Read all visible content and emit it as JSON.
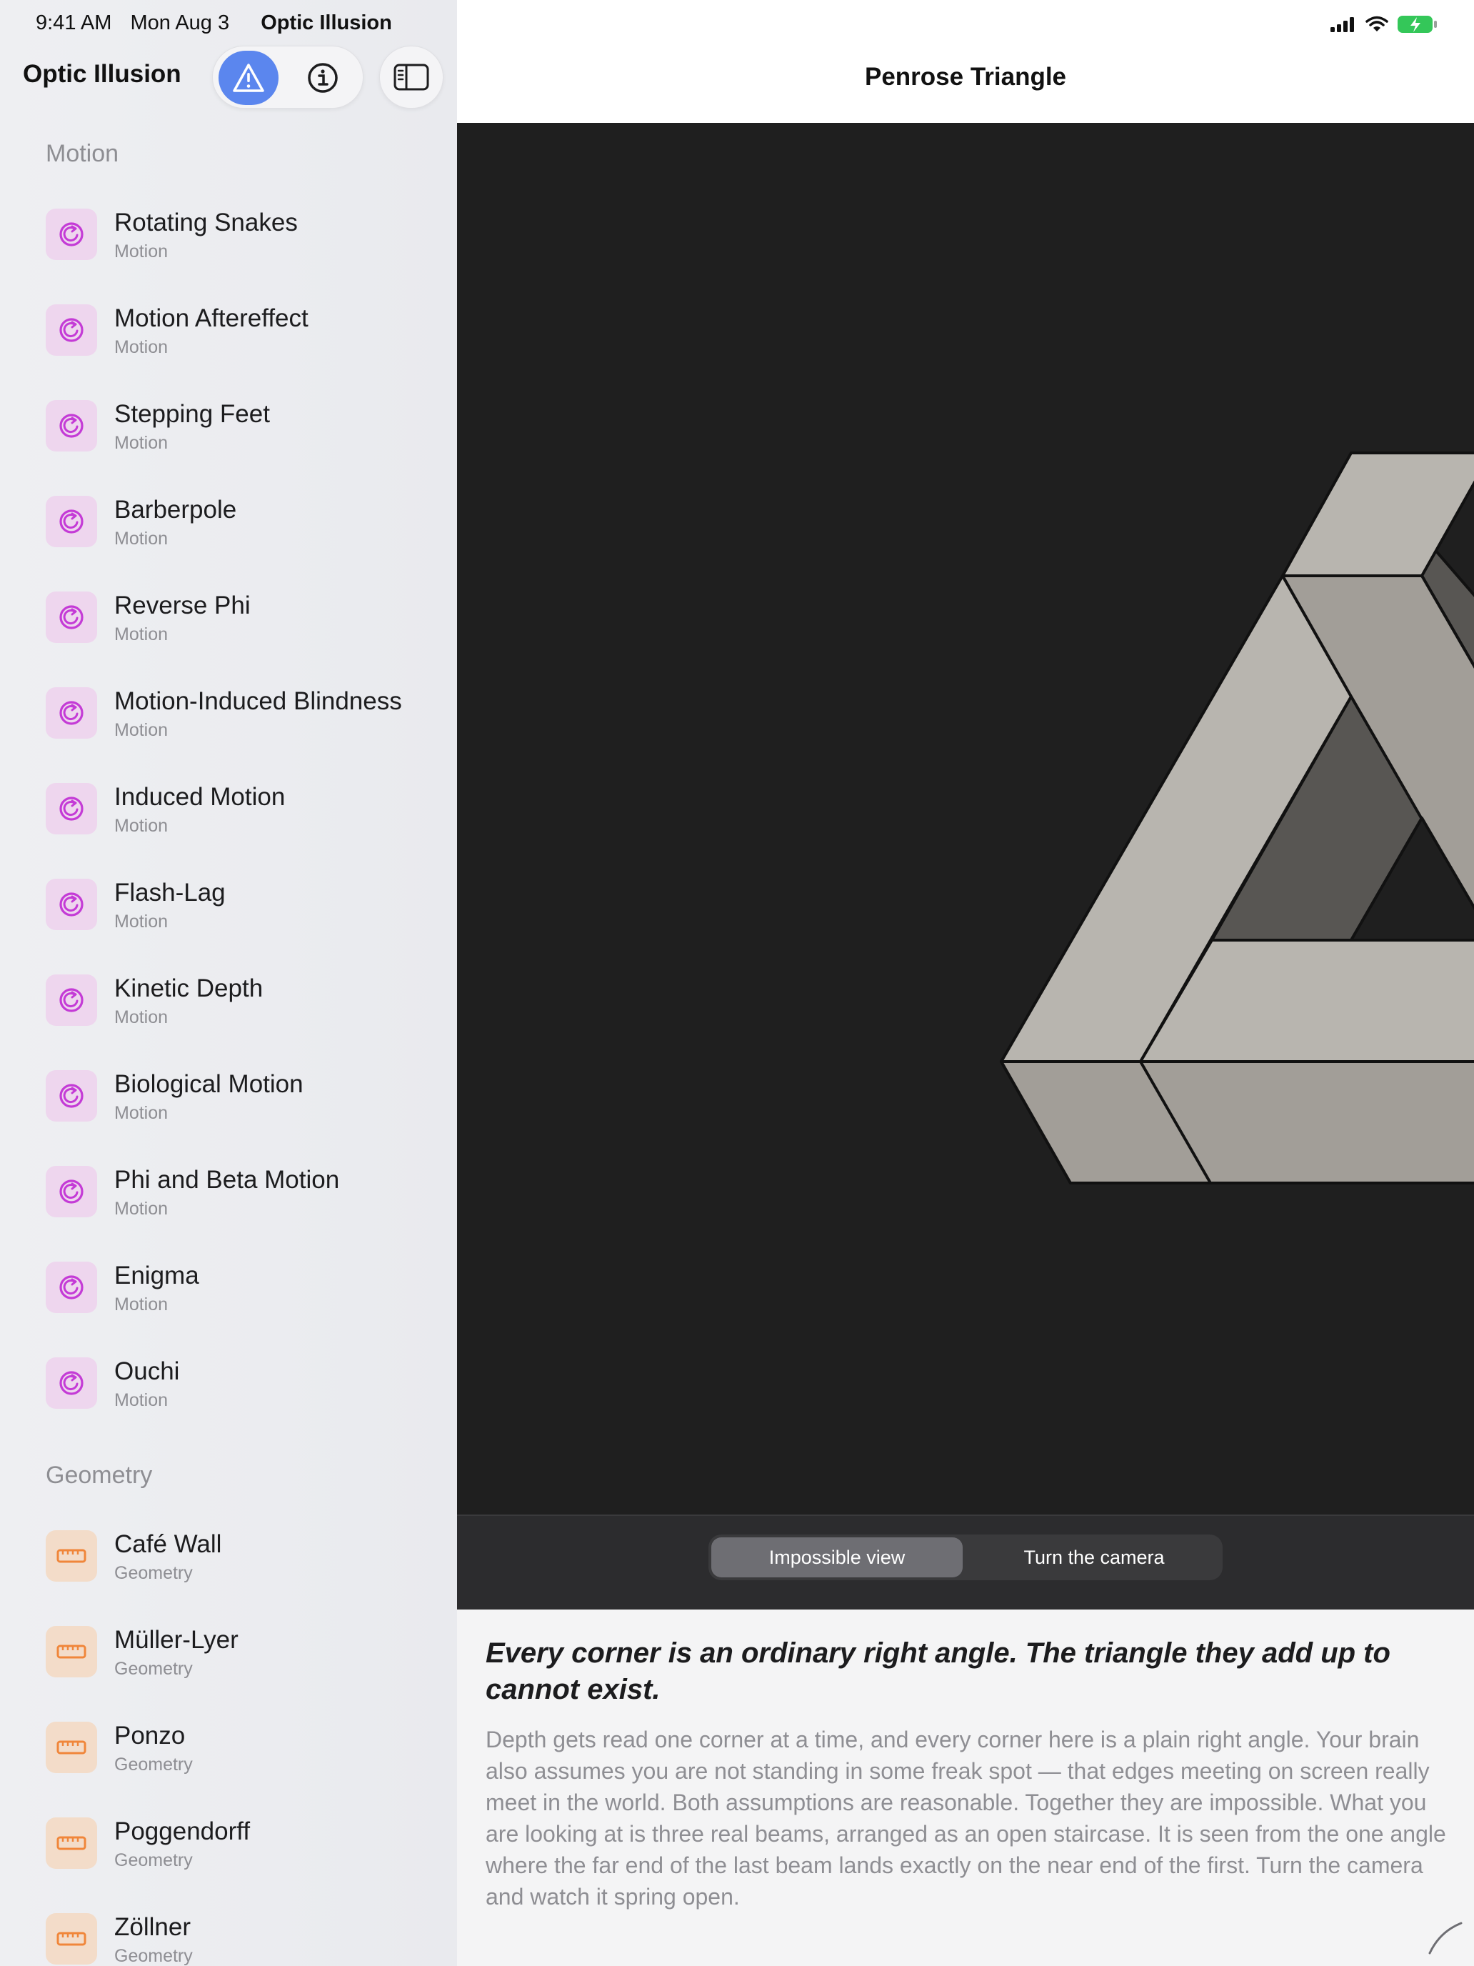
{
  "status_bar": {
    "time": "9:41 AM",
    "date": "Mon Aug 3",
    "app_name": "Optic Illusion",
    "battery_color": "#34c759"
  },
  "sidebar": {
    "title": "Optic Illusion",
    "warning_button_icon": "warning-triangle-icon",
    "info_button_icon": "info-circle-icon",
    "toggle_icon": "sidebar-toggle-icon",
    "accent": "#5b86ee",
    "sections": [
      {
        "header": "Motion",
        "icon": "rotate-arrow-icon",
        "icon_color": "#c43bd6",
        "items": [
          {
            "name": "Rotating Snakes",
            "category": "Motion"
          },
          {
            "name": "Motion Aftereffect",
            "category": "Motion"
          },
          {
            "name": "Stepping Feet",
            "category": "Motion"
          },
          {
            "name": "Barberpole",
            "category": "Motion"
          },
          {
            "name": "Reverse Phi",
            "category": "Motion"
          },
          {
            "name": "Motion-Induced Blindness",
            "category": "Motion"
          },
          {
            "name": "Induced Motion",
            "category": "Motion"
          },
          {
            "name": "Flash-Lag",
            "category": "Motion"
          },
          {
            "name": "Kinetic Depth",
            "category": "Motion"
          },
          {
            "name": "Biological Motion",
            "category": "Motion"
          },
          {
            "name": "Phi and Beta Motion",
            "category": "Motion"
          },
          {
            "name": "Enigma",
            "category": "Motion"
          },
          {
            "name": "Ouchi",
            "category": "Motion"
          }
        ]
      },
      {
        "header": "Geometry",
        "icon": "ruler-icon",
        "icon_color": "#f0863a",
        "items": [
          {
            "name": "Café Wall",
            "category": "Geometry"
          },
          {
            "name": "Müller-Lyer",
            "category": "Geometry"
          },
          {
            "name": "Ponzo",
            "category": "Geometry"
          },
          {
            "name": "Poggendorff",
            "category": "Geometry"
          },
          {
            "name": "Zöllner",
            "category": "Geometry"
          }
        ]
      }
    ]
  },
  "main": {
    "title": "Penrose Triangle",
    "segmented": {
      "options": [
        "Impossible view",
        "Turn the camera"
      ],
      "selected": "Impossible view"
    },
    "description": {
      "headline": "Every corner is an ordinary right angle. The triangle they add up to cannot exist.",
      "body": "Depth gets read one corner at a time, and every corner here is a plain right angle. Your brain also assumes you are not standing in some freak spot — that edges meeting on screen really meet in the world. Both assumptions are reasonable. Together they are impossible. What you are looking at is three real beams, arranged as an open staircase. It is seen from the one angle where the far end of the last beam lands exactly on the near end of the first. Turn the camera and watch it spring open."
    },
    "illustration": {
      "name": "penrose-triangle",
      "colors": {
        "light": "#b8b5af",
        "mid": "#a29e98",
        "dark": "#585653",
        "background": "#1f1f1f",
        "outline": "#111111"
      }
    }
  }
}
